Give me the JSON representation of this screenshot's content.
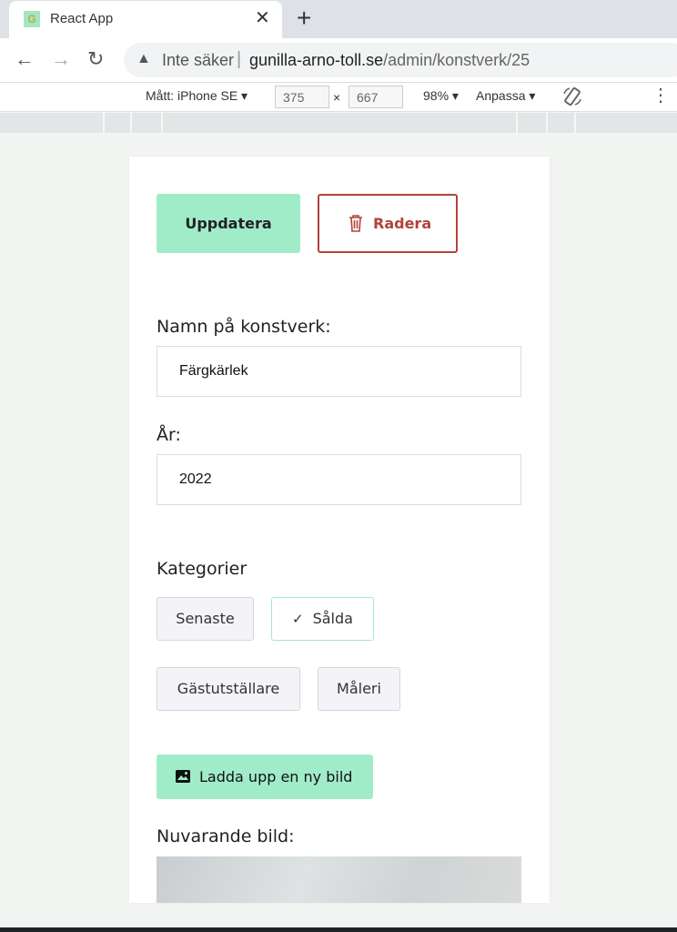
{
  "browser": {
    "tab_title": "React App",
    "tab_favicon_letter": "G",
    "security_label": "Inte säker",
    "url_host": "gunilla-arno-toll.se",
    "url_path": "/admin/konstverk/25"
  },
  "device_toolbar": {
    "dimensions_label": "Mått: iPhone SE",
    "width": "375",
    "height": "667",
    "zoom": "98%",
    "throttle": "Anpassa"
  },
  "artwork_form": {
    "update_label": "Uppdatera",
    "delete_label": "Radera",
    "name_label": "Namn på konstverk:",
    "name_value": "Färgkärlek",
    "year_label": "År:",
    "year_value": "2022",
    "categories_label": "Kategorier",
    "categories": [
      {
        "label": "Senaste",
        "selected": false
      },
      {
        "label": "Sålda",
        "selected": true
      },
      {
        "label": "Gästutställare",
        "selected": false
      },
      {
        "label": "Måleri",
        "selected": false
      }
    ],
    "upload_label": "Ladda upp en ny bild",
    "current_image_label": "Nuvarande bild:"
  },
  "colors": {
    "accent": "#a0ecc9",
    "danger": "#b0443a"
  }
}
